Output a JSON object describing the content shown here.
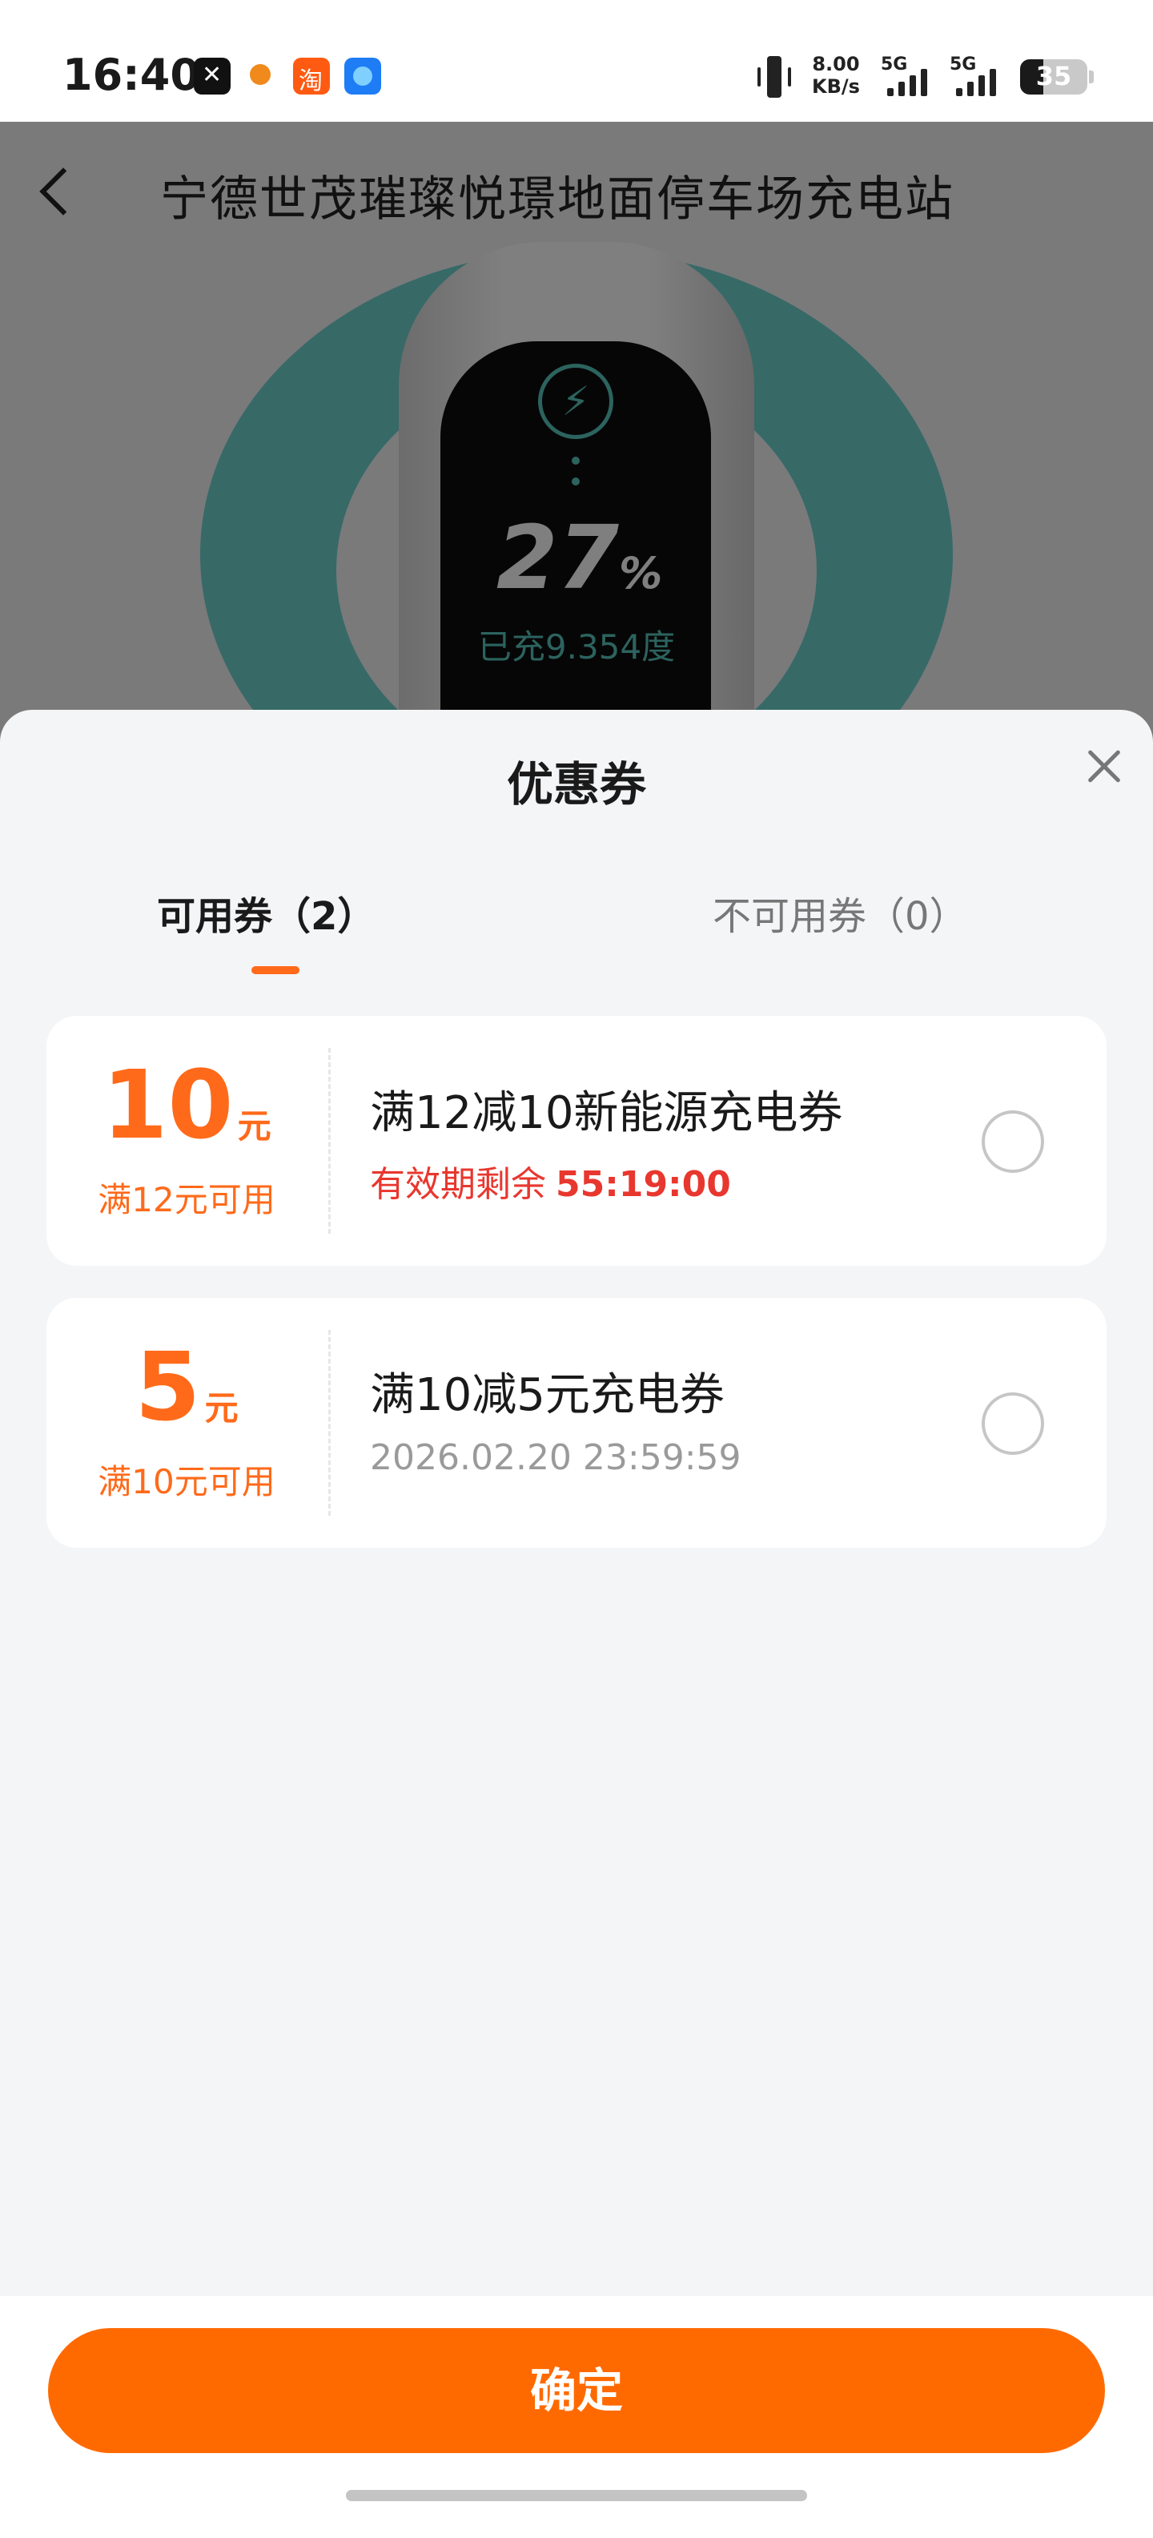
{
  "status_bar": {
    "time": "16:40",
    "network_speed_value": "8.00",
    "network_speed_unit": "KB/s",
    "sim1": "5G",
    "sim2": "5G",
    "battery": "35",
    "battery_level_percent": 35
  },
  "header": {
    "title": "宁德世茂璀璨悦璟地面停车场充电站"
  },
  "charging": {
    "percent_value": "27",
    "percent_sign": "%",
    "charged_text": "已充9.354度"
  },
  "sheet": {
    "title": "优惠券",
    "tabs": [
      {
        "label": "可用券（2）",
        "active": true
      },
      {
        "label": "不可用券（0）",
        "active": false
      }
    ],
    "coupons": [
      {
        "amount": "10",
        "unit": "元",
        "condition": "满12元可用",
        "name": "满12减10新能源充电券",
        "expiry_label": "有效期剩余",
        "expiry_value": "55:19:00",
        "selected": false
      },
      {
        "amount": "5",
        "unit": "元",
        "condition": "满10元可用",
        "name": "满10减5元充电券",
        "expiry_date": "2026.02.20 23:59:59",
        "selected": false
      }
    ],
    "confirm_label": "确定"
  },
  "colors": {
    "accent": "#ff6a00",
    "coupon_amount": "#ff6a1a",
    "expiry_red": "#e8372e",
    "ring_teal": "#6ed3cf"
  }
}
